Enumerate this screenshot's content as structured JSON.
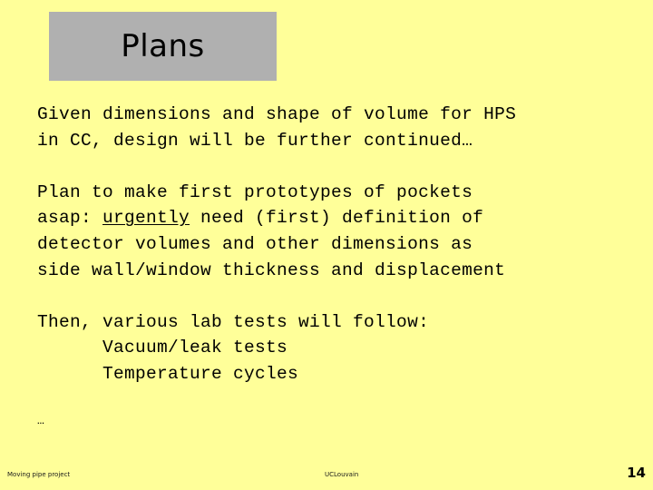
{
  "slide": {
    "background_color": "#ffff99",
    "title": {
      "text": "Plans",
      "box_color": "#b0b0b0"
    },
    "paragraphs": [
      {
        "id": "paragraph-1",
        "lines": [
          {
            "segments": [
              {
                "text": "Given dimensions and shape of volume for HPS"
              }
            ]
          },
          {
            "segments": [
              {
                "text": "in CC, design will be further continued…"
              }
            ]
          }
        ]
      },
      {
        "id": "paragraph-2",
        "lines": [
          {
            "segments": [
              {
                "text": "Plan to make first prototypes of pockets"
              }
            ]
          },
          {
            "segments": [
              {
                "text": "asap: "
              },
              {
                "text": "urgently",
                "style": "underline"
              },
              {
                "text": " need (first) definition of"
              }
            ]
          },
          {
            "segments": [
              {
                "text": "detector volumes and other dimensions as"
              }
            ]
          },
          {
            "segments": [
              {
                "text": "side wall/window thickness and displacement"
              }
            ]
          }
        ]
      },
      {
        "id": "paragraph-3",
        "lines": [
          {
            "segments": [
              {
                "text": "Then, various lab tests will follow:"
              }
            ]
          },
          {
            "indent": true,
            "segments": [
              {
                "text": "Vacuum/leak tests"
              }
            ]
          },
          {
            "indent": true,
            "segments": [
              {
                "text": "Temperature cycles"
              }
            ]
          }
        ]
      }
    ],
    "trailing_ellipsis": "…",
    "footer": {
      "left": "Moving pipe project",
      "center": "UCLouvain",
      "page_number": "14"
    }
  }
}
